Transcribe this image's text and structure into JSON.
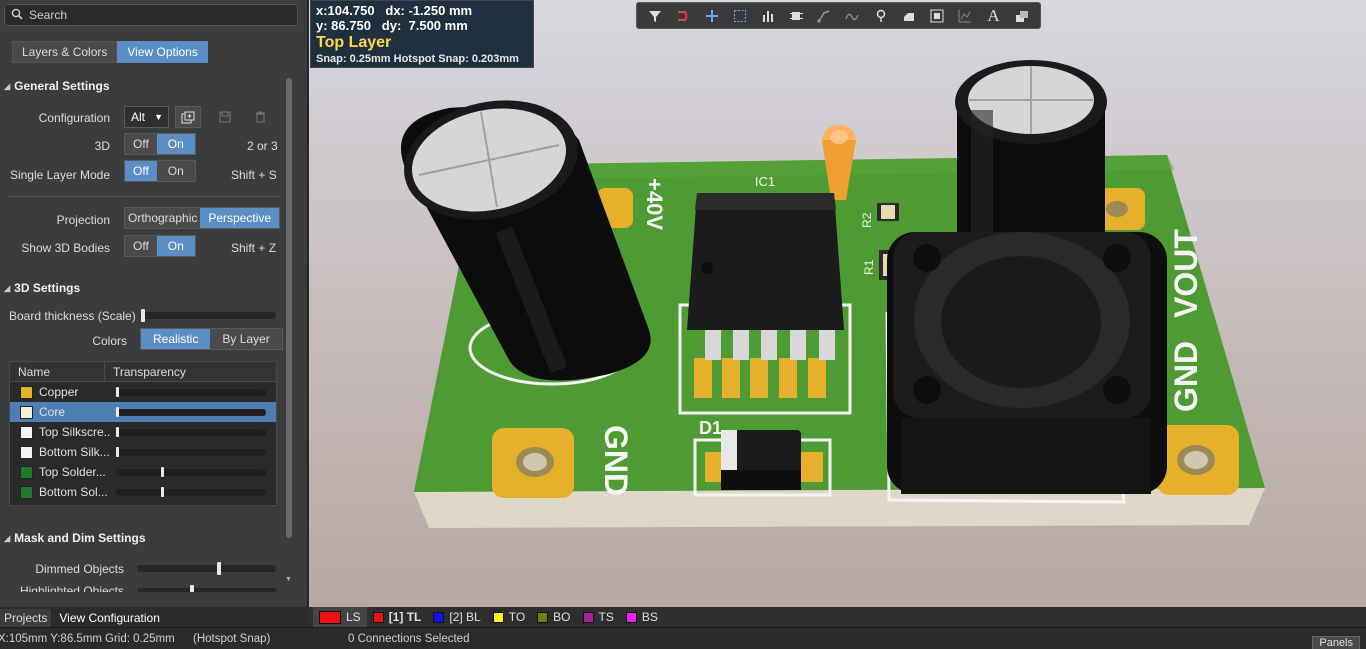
{
  "search": {
    "placeholder": "Search"
  },
  "panel_tabs": [
    {
      "label": "Layers & Colors",
      "active": false
    },
    {
      "label": "View Options",
      "active": true
    }
  ],
  "general": {
    "title": "General Settings",
    "configuration": {
      "label": "Configuration",
      "value": "Alt"
    },
    "three_d": {
      "label": "3D",
      "off": "Off",
      "on": "On",
      "selected": "On",
      "shortcut": "2 or 3"
    },
    "single_layer": {
      "label": "Single Layer Mode",
      "off": "Off",
      "on": "On",
      "selected": "Off",
      "shortcut": "Shift + S"
    },
    "projection": {
      "label": "Projection",
      "a": "Orthographic",
      "b": "Perspective",
      "selected": "Perspective"
    },
    "bodies": {
      "label": "Show 3D Bodies",
      "off": "Off",
      "on": "On",
      "selected": "On",
      "shortcut": "Shift + Z"
    }
  },
  "settings3d": {
    "title": "3D Settings",
    "thickness_label": "Board thickness (Scale)",
    "colors_label": "Colors",
    "realistic": "Realistic",
    "by_layer": "By Layer",
    "col_name": "Name",
    "col_transparency": "Transparency",
    "rows": [
      {
        "name": "Copper",
        "color": "#e6b02a",
        "level": 0.0,
        "selected": false
      },
      {
        "name": "Core",
        "color": "#f2f0d8",
        "level": 0.0,
        "selected": true
      },
      {
        "name": "Top Silkscre...",
        "color": "#f4f4f4",
        "level": 0.0,
        "selected": false
      },
      {
        "name": "Bottom Silk...",
        "color": "#f4f4f4",
        "level": 0.0,
        "selected": false
      },
      {
        "name": "Top Solder...",
        "color": "#1f7a2c",
        "level": 0.3,
        "selected": false
      },
      {
        "name": "Bottom Sol...",
        "color": "#1f7a2c",
        "level": 0.3,
        "selected": false
      }
    ]
  },
  "mask": {
    "title": "Mask and Dim Settings",
    "dimmed": "Dimmed Objects",
    "highlighted": "Highlighted Objects"
  },
  "bottom_tabs": [
    {
      "label": "Projects"
    },
    {
      "label": "View Configuration"
    }
  ],
  "coords": {
    "line1": "x:104.750   dx: -1.250 mm",
    "line2": "y: 86.750   dy:  7.500 mm",
    "layer": "Top Layer",
    "snap": "Snap: 0.25mm Hotspot Snap: 0.203mm"
  },
  "toolbar_icons": [
    "filter-icon",
    "route-icon",
    "plus-icon",
    "select-rect-icon",
    "bar-chart-icon",
    "chip-icon",
    "diff-pair-icon",
    "wave-icon",
    "place-pin-icon",
    "fill-icon",
    "component-icon",
    "graph-icon",
    "text-icon",
    "layers-icon"
  ],
  "pcb": {
    "labels": {
      "ic1": "IC1",
      "v40": "+40V",
      "r2": "R2",
      "r1": "R1",
      "d1": "D1",
      "gnd_left": "GND",
      "gnd_right": "GND",
      "vout": "VOUT"
    }
  },
  "layer_tabs": [
    {
      "label": "LS",
      "color": "#ee1111"
    },
    {
      "label": "[1] TL",
      "color": "#ee1111"
    },
    {
      "label": "[2] BL",
      "color": "#1111ee"
    },
    {
      "label": "TO",
      "color": "#ffee22"
    },
    {
      "label": "BO",
      "color": "#7a7a1a"
    },
    {
      "label": "TS",
      "color": "#aa2299"
    },
    {
      "label": "BS",
      "color": "#ee22ee"
    }
  ],
  "status": {
    "pos": "X:105mm Y:86.5mm",
    "grid": "Grid: 0.25mm",
    "snap": "(Hotspot Snap)",
    "connections": "0 Connections Selected",
    "panels": "Panels"
  }
}
